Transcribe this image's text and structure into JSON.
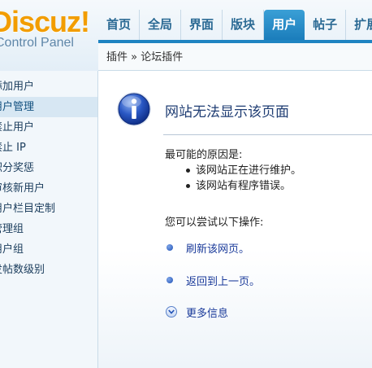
{
  "brand": {
    "logo_text": "Discuz!",
    "subtitle": "Control Panel",
    "logo_color": "#f29d00"
  },
  "nav": {
    "tabs": [
      {
        "label": "首页"
      },
      {
        "label": "全局"
      },
      {
        "label": "界面"
      },
      {
        "label": "版块"
      },
      {
        "label": "用户",
        "active": true
      },
      {
        "label": "帖子"
      },
      {
        "label": "扩展"
      }
    ],
    "accent_color": "#1f84c2"
  },
  "breadcrumb": "插件 » 论坛插件",
  "sidebar": {
    "items": [
      {
        "label": "添加用户"
      },
      {
        "label": "用户管理",
        "active": true
      },
      {
        "label": "禁止用户"
      },
      {
        "label": "禁止 IP"
      },
      {
        "label": "积分奖惩"
      },
      {
        "label": "审核新用户"
      },
      {
        "label": "用户栏目定制"
      },
      {
        "label": "管理组"
      },
      {
        "label": "用户组"
      },
      {
        "label": "发帖数级别"
      }
    ]
  },
  "error_page": {
    "icon": "info-icon",
    "title": "网站无法显示该页面",
    "reasons_title": "最可能的原因是:",
    "reasons": [
      "该网站正在进行维护。",
      "该网站有程序错误。"
    ],
    "try_title": "您可以尝试以下操作:",
    "actions": [
      {
        "label": "刷新该网页。"
      },
      {
        "label": "返回到上一页。"
      },
      {
        "label": "更多信息"
      }
    ]
  }
}
